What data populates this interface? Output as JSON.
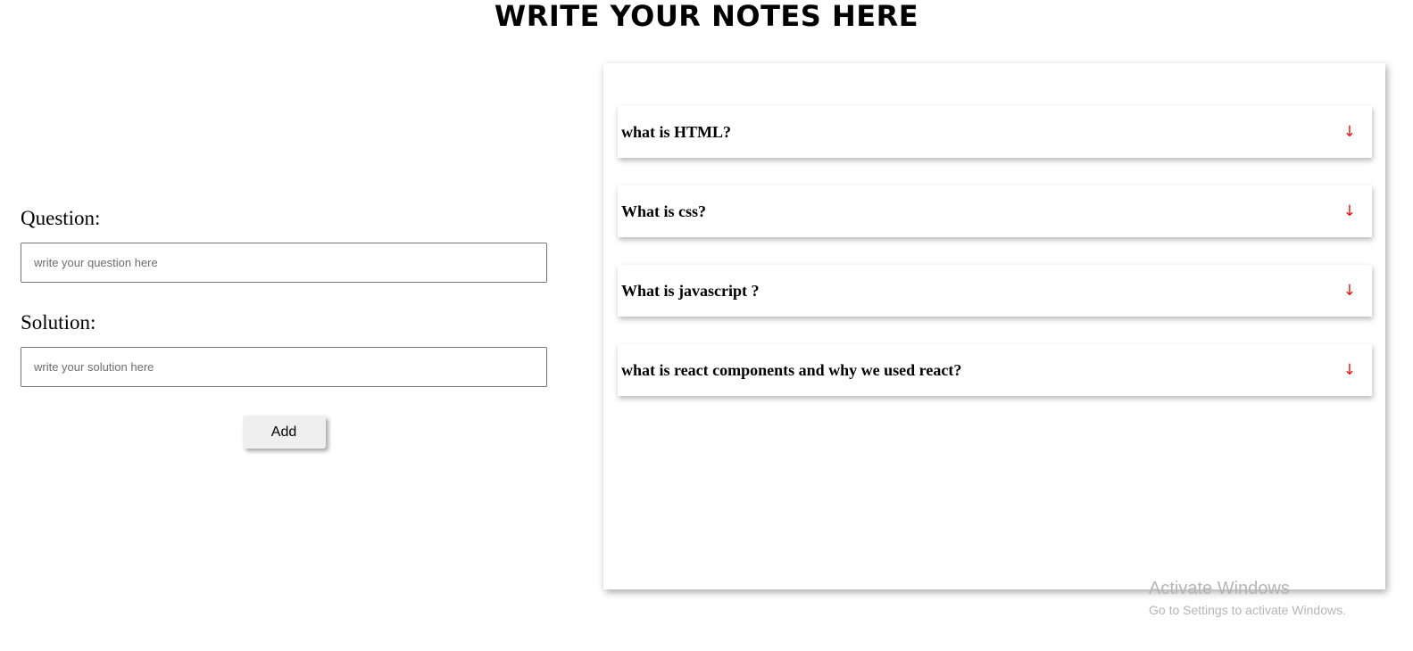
{
  "header": {
    "title": "WRITE YOUR NOTES HERE"
  },
  "form": {
    "question_label": "Question:",
    "question_placeholder": "write your question here",
    "question_value": "",
    "solution_label": "Solution:",
    "solution_placeholder": "write your solution here",
    "solution_value": "",
    "add_label": "Add"
  },
  "notes": {
    "items": [
      {
        "question": "what is HTML?",
        "icon": "arrow-down-icon"
      },
      {
        "question": "What is css?",
        "icon": "arrow-down-icon"
      },
      {
        "question": "What is javascript ?",
        "icon": "arrow-down-icon"
      },
      {
        "question": "what is react components and why we used react?",
        "icon": "arrow-down-icon"
      }
    ],
    "icon_glyph": "↓",
    "accent_color": "#ee1111"
  },
  "watermark": {
    "title": "Activate Windows",
    "subtitle": "Go to Settings to activate Windows."
  }
}
